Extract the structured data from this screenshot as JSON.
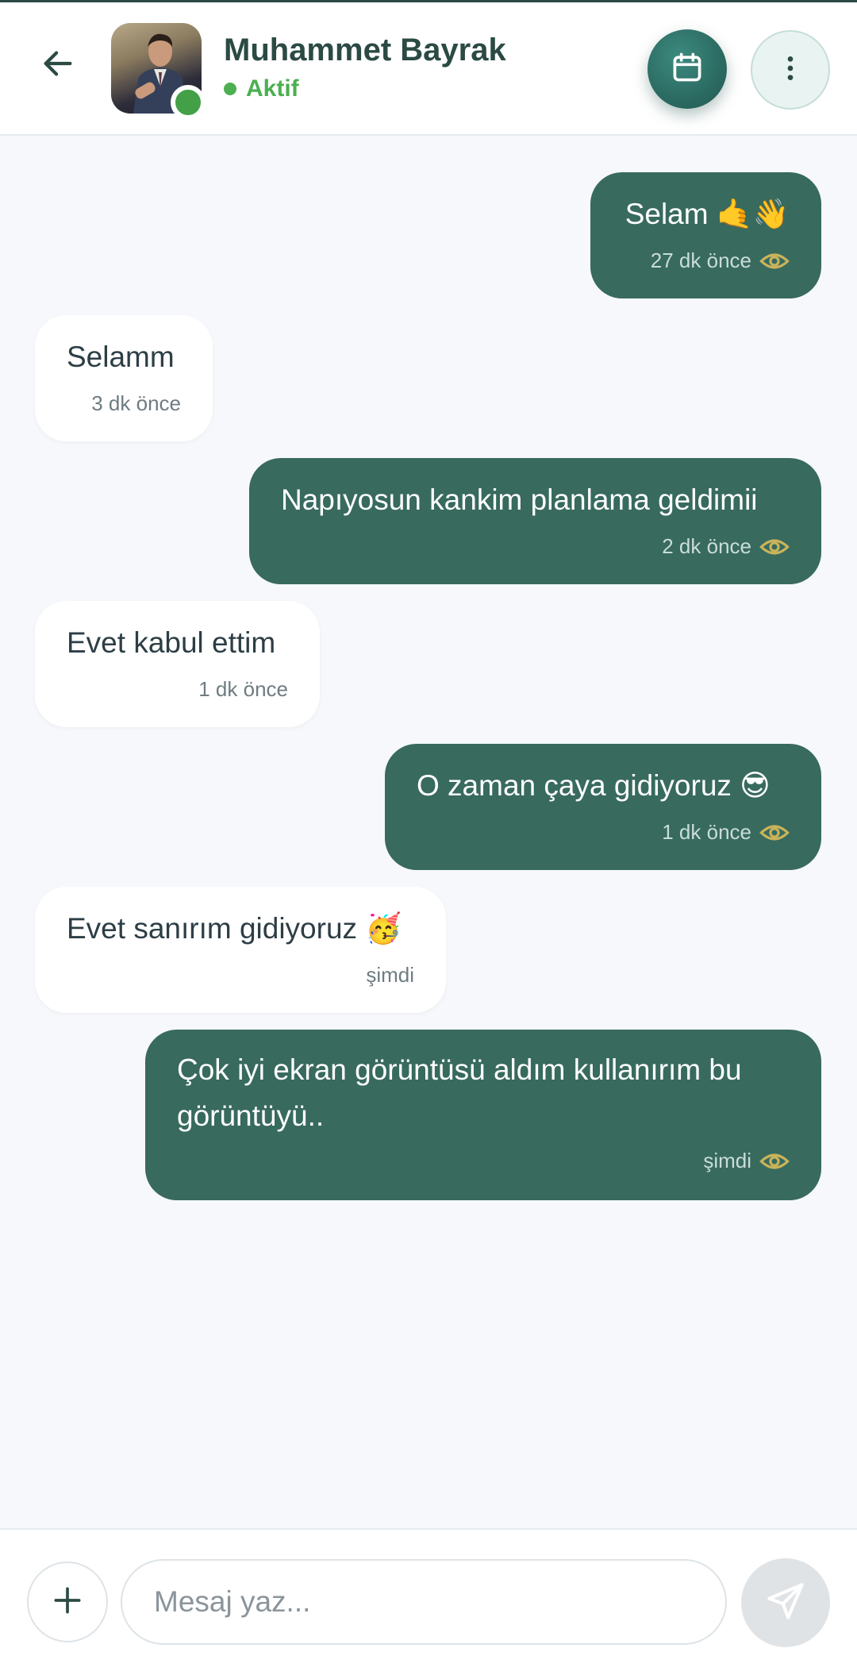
{
  "header": {
    "contact_name": "Muhammet Bayrak",
    "status": "Aktif",
    "back_icon": "arrow-left-icon",
    "calendar_icon": "calendar-icon",
    "more_icon": "more-vertical-icon"
  },
  "messages": [
    {
      "direction": "out",
      "text": "Selam 🤙👋",
      "time": "27 dk önce",
      "seen_icon": "eye-icon"
    },
    {
      "direction": "in",
      "text": "Selamm",
      "time": "3 dk önce"
    },
    {
      "direction": "out",
      "text": "Napıyosun kankim planlama geldimii",
      "time": "2 dk önce",
      "seen_icon": "eye-icon"
    },
    {
      "direction": "in",
      "text": "Evet kabul ettim",
      "time": "1 dk önce"
    },
    {
      "direction": "out",
      "text": "O zaman çaya gidiyoruz 😎",
      "time": "1 dk önce",
      "seen_icon": "eye-icon"
    },
    {
      "direction": "in",
      "text": "Evet sanırım gidiyoruz 🥳",
      "time": "şimdi"
    },
    {
      "direction": "out",
      "text": "Çok iyi ekran görüntüsü aldım kullanırım bu görüntüyü..",
      "time": "şimdi",
      "seen_icon": "eye-icon"
    }
  ],
  "composer": {
    "placeholder": "Mesaj yaz...",
    "value": "",
    "add_icon": "plus-icon",
    "send_icon": "send-icon"
  },
  "colors": {
    "accent": "#386a5e",
    "header_text": "#2b4a44",
    "online": "#4caf50",
    "seen_eye": "#c9b35a",
    "background": "#f6f8fb"
  }
}
